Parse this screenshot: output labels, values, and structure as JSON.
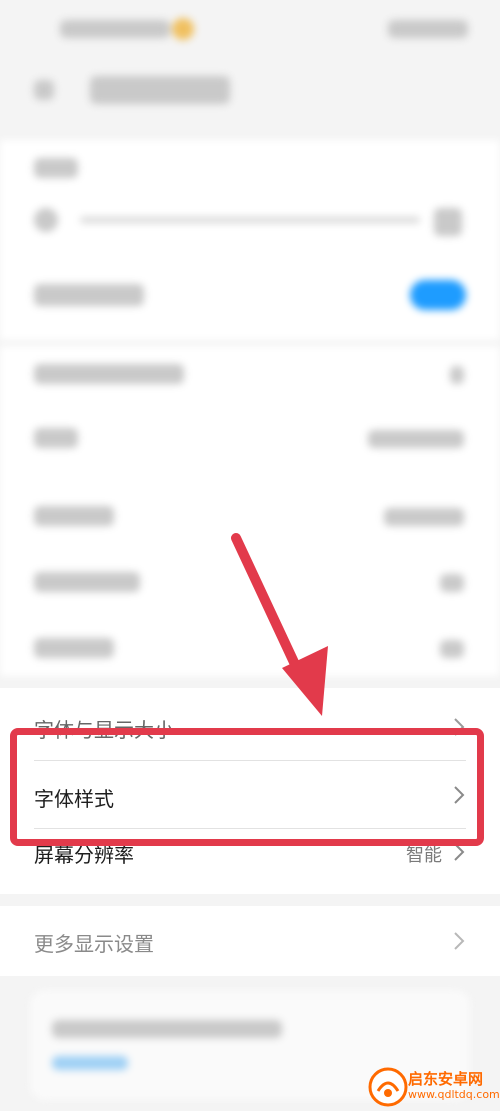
{
  "settings": {
    "rows": [
      {
        "label": "字体与显示大小"
      },
      {
        "label": "字体样式"
      },
      {
        "label": "屏幕分辨率",
        "value": "智能"
      },
      {
        "label": "更多显示设置"
      }
    ]
  },
  "colors": {
    "highlight": "#e23a4b",
    "toggle": "#1e9cff",
    "watermark": "#ff6a00"
  },
  "watermark": {
    "brand": "启东安卓网",
    "url": "www.qdltdq.com"
  }
}
